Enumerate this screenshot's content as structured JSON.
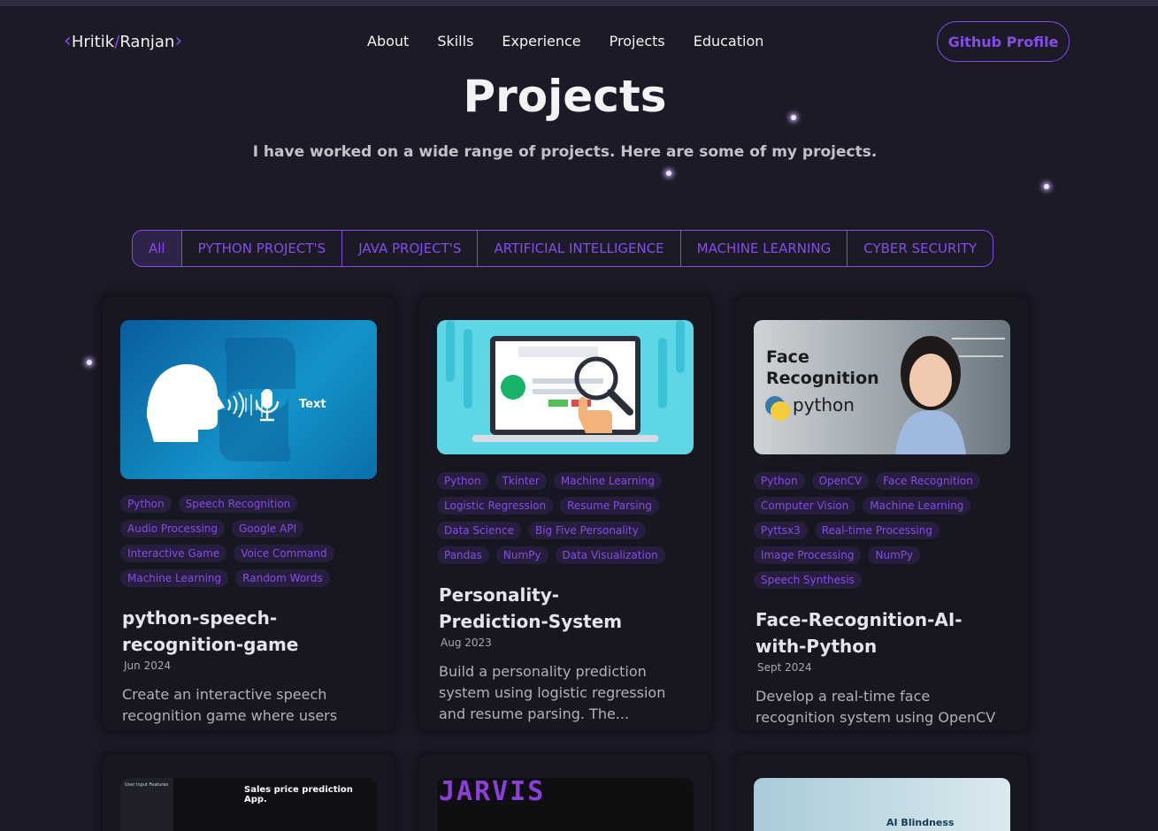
{
  "nav": {
    "logo_first": "Hritik",
    "logo_slash": "/",
    "logo_last": "Ranjan",
    "links": [
      "About",
      "Skills",
      "Experience",
      "Projects",
      "Education"
    ],
    "github_label": "Github Profile"
  },
  "page": {
    "title": "Projects",
    "subtitle": "I have worked on a wide range of projects. Here are some of my projects."
  },
  "filters": [
    "All",
    "PYTHON PROJECT'S",
    "JAVA PROJECT'S",
    "ARTIFICIAL INTELLIGENCE",
    "MACHINE LEARNING",
    "CYBER SECURITY"
  ],
  "cards": [
    {
      "thumb_text": "Text",
      "tags": [
        "Python",
        "Speech Recognition",
        "Audio Processing",
        "Google API",
        "Interactive Game",
        "Voice Command",
        "Machine Learning",
        "Random Words"
      ],
      "title": "python-speech-recognition-game",
      "date": "Jun 2024",
      "desc": "Create an interactive speech recognition game where users"
    },
    {
      "thumb_text": "",
      "tags": [
        "Python",
        "Tkinter",
        "Machine Learning",
        "Logistic Regression",
        "Resume Parsing",
        "Data Science",
        "Big Five Personality",
        "Pandas",
        "NumPy",
        "Data Visualization"
      ],
      "title": "Personality-Prediction-System",
      "date": "Aug 2023",
      "desc": "Build a personality prediction system using logistic regression and resume parsing. The..."
    },
    {
      "thumb_text": "Face Recognition",
      "thumb_sub": "python",
      "tags": [
        "Python",
        "OpenCV",
        "Face Recognition",
        "Computer Vision",
        "Machine Learning",
        "Pyttsx3",
        "Real-time Processing",
        "Image Processing",
        "NumPy",
        "Speech Synthesis"
      ],
      "title": "Face-Recognition-AI-with-Python",
      "date": "Sept 2024",
      "desc": "Develop a real-time face recognition system using OpenCV"
    },
    {
      "thumb_text": "Sales price prediction App.",
      "thumb_sub": "User Input Features"
    },
    {
      "thumb_text": "JARVIS"
    },
    {
      "thumb_text": "AI Blindness"
    }
  ]
}
